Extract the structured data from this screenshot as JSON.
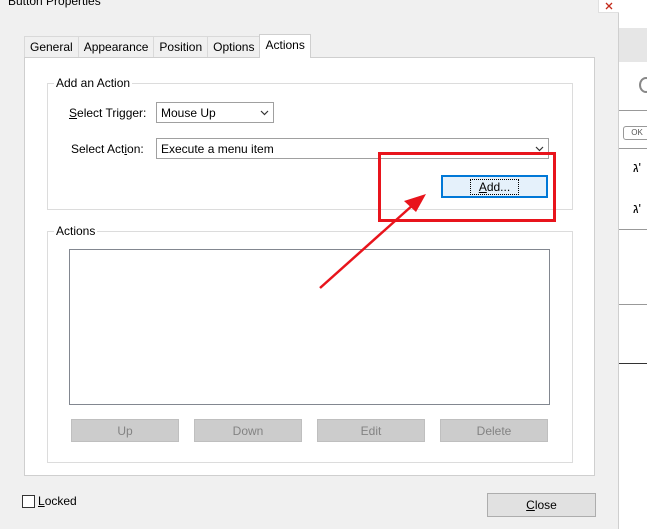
{
  "window": {
    "title": "Button Properties"
  },
  "tabs": [
    {
      "label": "General"
    },
    {
      "label": "Appearance"
    },
    {
      "label": "Position"
    },
    {
      "label": "Options"
    },
    {
      "label": "Actions",
      "active": true
    }
  ],
  "add_action": {
    "legend": "Add an Action",
    "trigger": {
      "label_pre": "S",
      "label_rest": "elect Trigger:",
      "value": "Mouse Up"
    },
    "action": {
      "label_pre": "Select Act",
      "label_ul": "i",
      "label_post": "on:",
      "value": "Execute a menu item"
    },
    "add_button": {
      "label_ul": "A",
      "label_rest": "dd..."
    }
  },
  "actions_group": {
    "legend": "Actions",
    "buttons": [
      {
        "label": "Up",
        "disabled": true
      },
      {
        "label": "Down",
        "disabled": true
      },
      {
        "label": "Edit",
        "disabled": true
      },
      {
        "label": "Delete",
        "disabled": true
      }
    ]
  },
  "footer": {
    "locked": {
      "label_ul": "L",
      "label_rest": "ocked",
      "checked": false
    },
    "close_button": {
      "label_ul": "C",
      "label_rest": "lose"
    }
  },
  "background_panel": {
    "hebrew_1": "ג'",
    "hebrew_2": "ג'",
    "ok_badge": "OK"
  },
  "icons": [
    "close-icon",
    "chevron-down-icon"
  ],
  "colors": {
    "annotation": "#e8141c",
    "focus": "#0078d7"
  }
}
